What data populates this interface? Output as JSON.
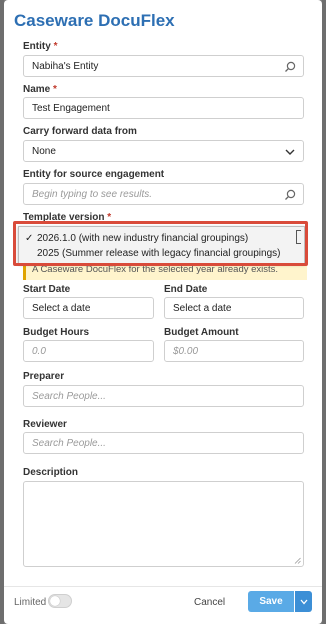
{
  "dialog": {
    "title": "Caseware DocuFlex"
  },
  "form": {
    "entity": {
      "label": "Entity",
      "required_mark": "*",
      "value": "Nabiha's Entity"
    },
    "name": {
      "label": "Name",
      "required_mark": "*",
      "value": "Test Engagement"
    },
    "carry_forward": {
      "label": "Carry forward data from",
      "value": "None"
    },
    "source_engagement": {
      "label": "Entity for source engagement",
      "placeholder": "Begin typing to see results."
    },
    "template_version": {
      "label": "Template version",
      "required_mark": "*",
      "options": [
        {
          "check": "✓",
          "label": "2026.1.0 (with new industry financial groupings)"
        },
        {
          "check": "",
          "label": "2025 (Summer release with legacy financial groupings)"
        }
      ]
    },
    "warning_text": "A Caseware DocuFlex for the selected year already exists.",
    "start_date": {
      "label": "Start Date",
      "value": "Select a date"
    },
    "end_date": {
      "label": "End Date",
      "value": "Select a date"
    },
    "budget_hours": {
      "label": "Budget Hours",
      "placeholder": "0.0"
    },
    "budget_amount": {
      "label": "Budget Amount",
      "placeholder": "$0.00"
    },
    "preparer": {
      "label": "Preparer",
      "placeholder": "Search People..."
    },
    "reviewer": {
      "label": "Reviewer",
      "placeholder": "Search People..."
    },
    "description": {
      "label": "Description"
    }
  },
  "footer": {
    "limited_label": "Limited",
    "cancel_label": "Cancel",
    "save_label": "Save"
  },
  "colors": {
    "accent": "#2d6fb3",
    "primary_button": "#5aaae6",
    "highlight_border": "#d94b3a",
    "required": "#c0392b"
  },
  "icons": {
    "entity_field": "search-icon",
    "source_engagement_field": "search-icon",
    "carry_forward_field": "chevron-down-icon",
    "save_split": "chevron-down-icon"
  }
}
